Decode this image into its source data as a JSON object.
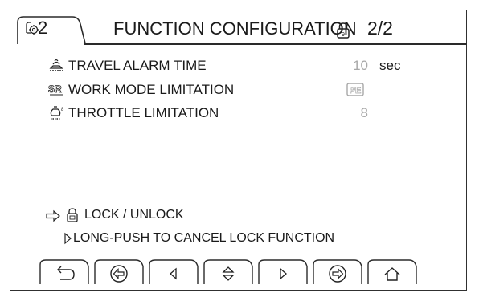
{
  "header": {
    "page_label": "2",
    "title": "FUNCTION CONFIGURATION",
    "page_indicator": "2/2",
    "icons": [
      "gear-tab-icon",
      "lock-icon"
    ]
  },
  "settings": [
    {
      "icon": "travel-alarm-icon",
      "label": "TRAVEL ALARM TIME",
      "value": "10",
      "unit": "sec"
    },
    {
      "icon": "work-mode-icon",
      "label": "WORK MODE LIMITATION",
      "value": "PE",
      "unit": ""
    },
    {
      "icon": "throttle-icon",
      "label": "THROTTLE LIMITATION",
      "value": "8",
      "unit": ""
    }
  ],
  "info": {
    "lock_unlock": "LOCK / UNLOCK",
    "long_push": "LONG-PUSH TO CANCEL LOCK FUNCTION"
  },
  "softkeys": [
    {
      "name": "back-button",
      "icon": "return-arrow-icon"
    },
    {
      "name": "previous-page-button",
      "icon": "circle-arrow-left-icon"
    },
    {
      "name": "left-button",
      "icon": "triangle-left-icon"
    },
    {
      "name": "up-down-button",
      "icon": "triangle-up-down-icon"
    },
    {
      "name": "right-button",
      "icon": "triangle-right-icon"
    },
    {
      "name": "next-page-button",
      "icon": "circle-arrow-right-icon"
    },
    {
      "name": "home-button",
      "icon": "home-icon"
    }
  ],
  "colors": {
    "value_grey": "#a8a8a8",
    "text": "#1a1a1a",
    "frame": "#303030"
  }
}
